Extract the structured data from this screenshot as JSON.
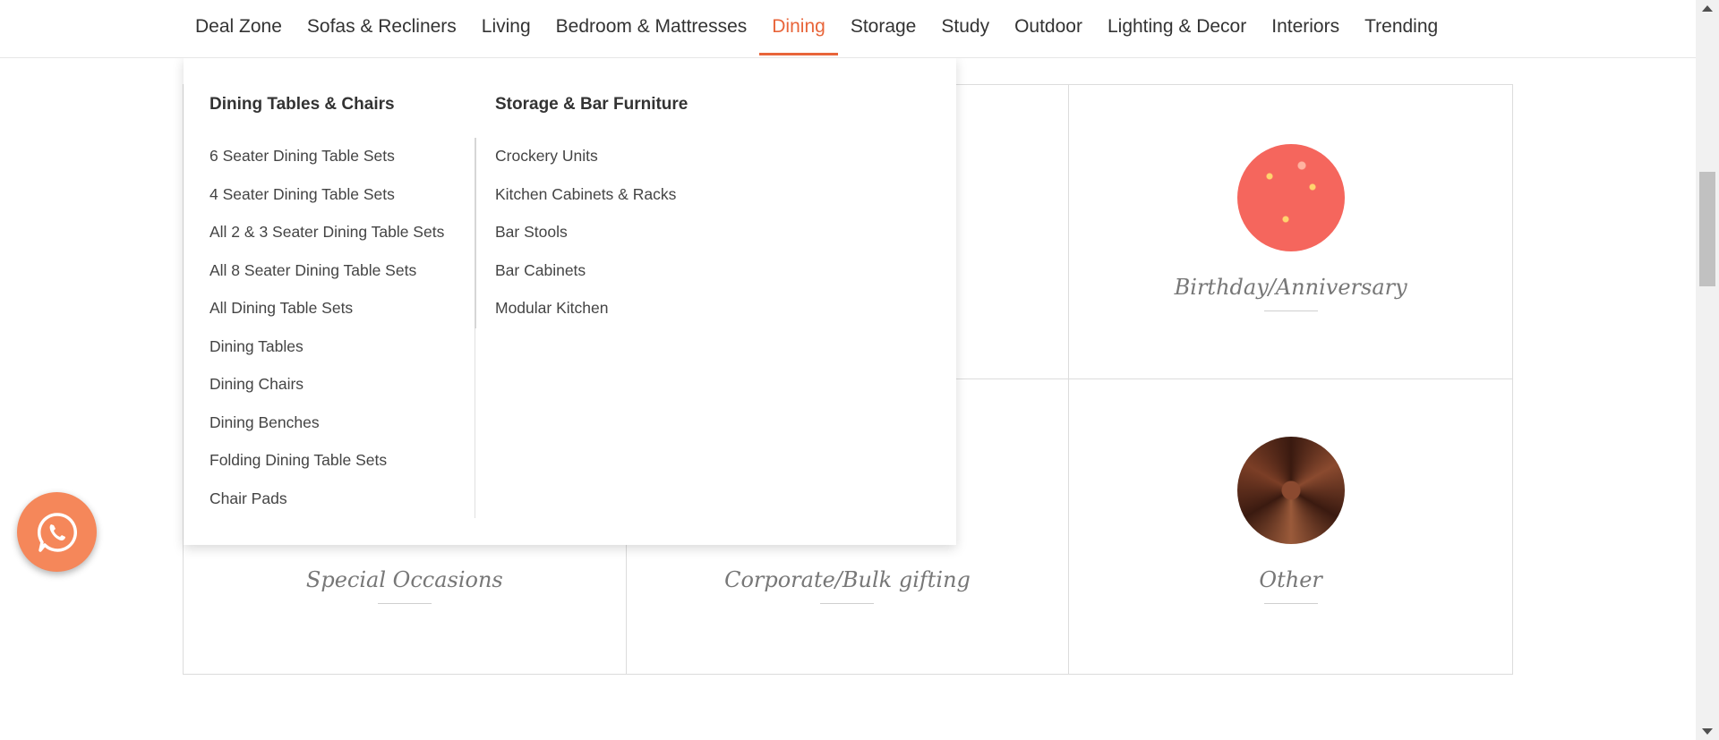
{
  "topnav": {
    "items": [
      {
        "label": "Deal Zone"
      },
      {
        "label": "Sofas & Recliners"
      },
      {
        "label": "Living"
      },
      {
        "label": "Bedroom & Mattresses"
      },
      {
        "label": "Dining"
      },
      {
        "label": "Storage"
      },
      {
        "label": "Study"
      },
      {
        "label": "Outdoor"
      },
      {
        "label": "Lighting & Decor"
      },
      {
        "label": "Interiors"
      },
      {
        "label": "Trending"
      }
    ],
    "active": "Dining",
    "accent_color": "#e8653a"
  },
  "mega_menu": {
    "col1": {
      "heading": "Dining Tables & Chairs",
      "items": [
        "6 Seater Dining Table Sets",
        "4 Seater Dining Table Sets",
        "All 2 & 3 Seater Dining Table Sets",
        "All 8 Seater Dining Table Sets",
        "All Dining Table Sets",
        "Dining Tables",
        "Dining Chairs",
        "Dining Benches",
        "Folding Dining Table Sets",
        "Chair Pads"
      ]
    },
    "col2": {
      "heading": "Storage & Bar Furniture",
      "items": [
        "Crockery Units",
        "Kitchen Cabinets & Racks",
        "Bar Stools",
        "Bar Cabinets",
        "Modular Kitchen"
      ]
    }
  },
  "occasions": {
    "birthday": {
      "title": "Birthday/Anniversary",
      "image": "confetti-pattern",
      "color": "#f5665d"
    },
    "special": {
      "title": "Special Occasions"
    },
    "corporate": {
      "title": "Corporate/Bulk gifting"
    },
    "other": {
      "title": "Other",
      "image": "brown-mandala-pattern",
      "color": "#5a2a18"
    }
  },
  "whatsapp": {
    "icon": "whatsapp-icon",
    "color": "#f5875a"
  }
}
